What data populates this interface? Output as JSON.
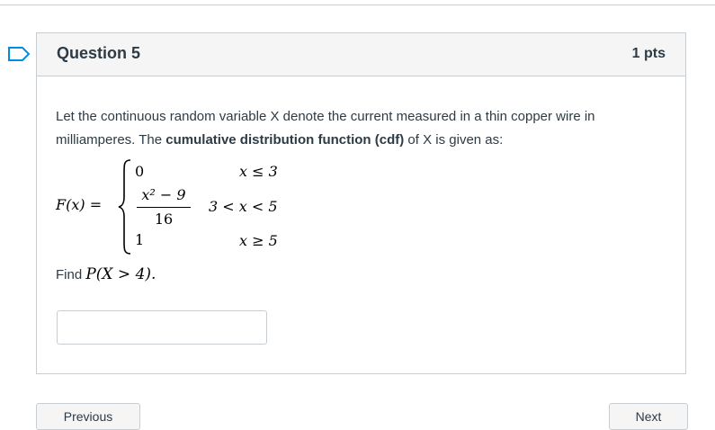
{
  "question": {
    "title": "Question 5",
    "points": "1 pts",
    "prompt_part1": "Let the continuous random variable X denote the current measured in a thin copper wire in milliamperes. The ",
    "prompt_bold": "cumulative distribution function (cdf)",
    "prompt_part2": " of X is given as:",
    "cdf": {
      "lhs": "F(x) =",
      "case1_value": "0",
      "case1_condition": "x ≤ 3",
      "case2_numerator": "x² − 9",
      "case2_denominator": "16",
      "case2_condition": "3 < x < 5",
      "case3_value": "1",
      "case3_condition": "x ≥ 5"
    },
    "find_label": "Find ",
    "find_math": "P(X > 4).",
    "answer_value": ""
  },
  "navigation": {
    "previous_label": "Previous",
    "next_label": "Next"
  }
}
